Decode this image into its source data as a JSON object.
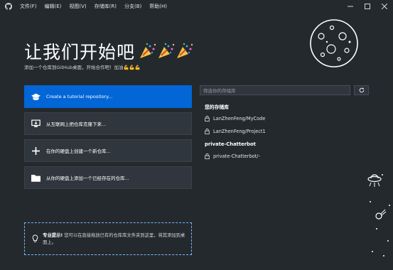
{
  "menu": {
    "items": [
      {
        "label": "文件(F)"
      },
      {
        "label": "编辑(E)"
      },
      {
        "label": "视图(V)"
      },
      {
        "label": "存储库(R)"
      },
      {
        "label": "分支(B)"
      },
      {
        "label": "帮助(H)"
      }
    ]
  },
  "welcome": {
    "title": "让我们开始吧",
    "subtitle": "添加一个仓库到GitHub桌面，开始合作吧！加油💪💪💪"
  },
  "actions": [
    {
      "label": "Create a tutorial repository...",
      "icon": "graduation-cap-icon"
    },
    {
      "label": "从互联网上把仓库克隆下来...",
      "icon": "desktop-download-icon"
    },
    {
      "label": "在你的硬盘上创建一个新仓库...",
      "icon": "plus-icon"
    },
    {
      "label": "从你的硬盘上添加一个已经存在的仓库...",
      "icon": "folder-icon"
    }
  ],
  "tip": {
    "bold": "专业提示!",
    "text": " 您可以在直接拖放已有的仓库库文件夹到这里，将其添加到桌面上。"
  },
  "repos_panel": {
    "filter_placeholder": "筛选你的存储库",
    "groups": [
      {
        "title": "您的存储库",
        "repos": [
          "LanZhenFeng/MyCode",
          "LanZhenFeng/Project1"
        ]
      },
      {
        "title": "private-Chatterbot",
        "repos": [
          "private-Chatterbot/-"
        ]
      }
    ]
  },
  "colors": {
    "background": "#24292e",
    "primary": "#0366d6",
    "card": "#2f363d",
    "tip_border": "#79b8ff"
  }
}
